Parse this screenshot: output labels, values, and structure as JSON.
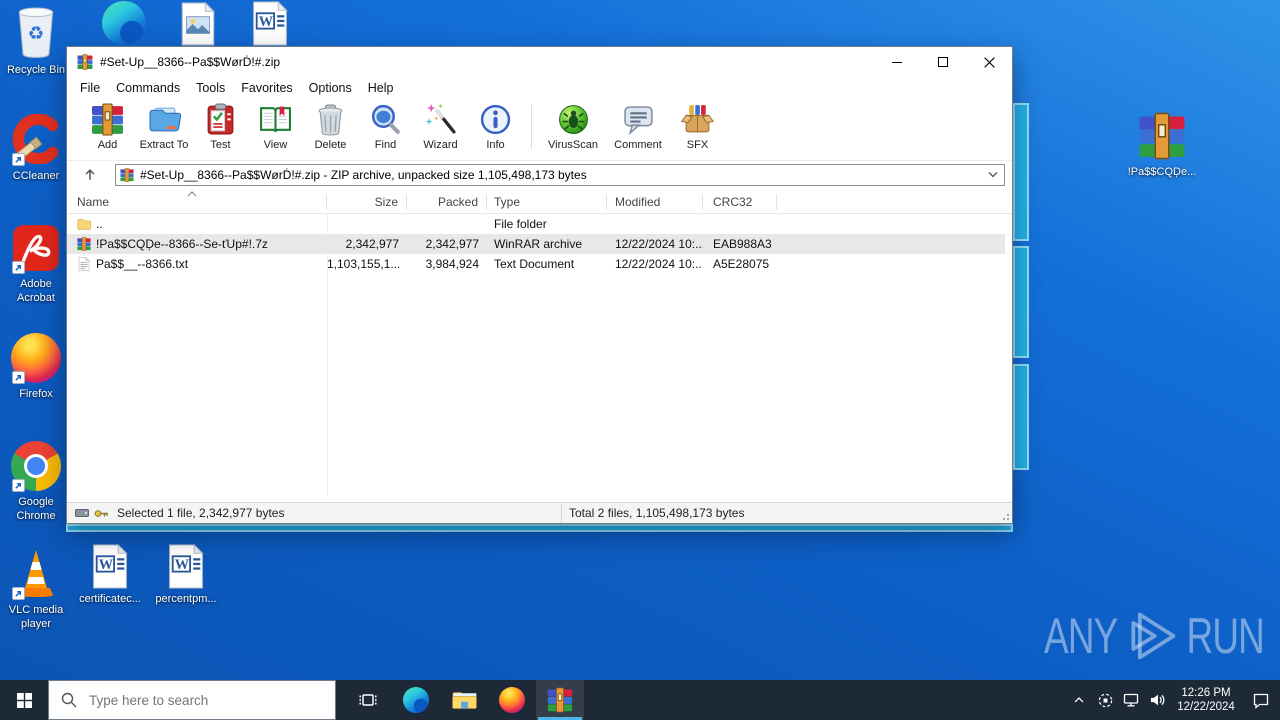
{
  "window": {
    "title": "#Set-Up__8366--Pa$$WørḊ!#.zip",
    "menu": [
      "File",
      "Commands",
      "Tools",
      "Favorites",
      "Options",
      "Help"
    ],
    "toolbar": [
      "Add",
      "Extract To",
      "Test",
      "View",
      "Delete",
      "Find",
      "Wizard",
      "Info",
      "VirusScan",
      "Comment",
      "SFX"
    ],
    "address": "#Set-Up__8366--Pa$$WørḊ!#.zip - ZIP archive, unpacked size 1,105,498,173 bytes",
    "columns": [
      "Name",
      "Size",
      "Packed",
      "Type",
      "Modified",
      "CRC32"
    ],
    "files": [
      {
        "name": "..",
        "size": "",
        "packed": "",
        "type": "File folder",
        "modified": "",
        "crc32": ""
      },
      {
        "name": "!Pa$$CQḐe--8366--Se-ťUp#!.7z",
        "size": "2,342,977",
        "packed": "2,342,977",
        "type": "WinRAR archive",
        "modified": "12/22/2024 10:...",
        "crc32": "EAB988A3"
      },
      {
        "name": "Pa$$__--8366.txt",
        "size": "1,103,155,1...",
        "packed": "3,984,924",
        "type": "Text Document",
        "modified": "12/22/2024 10:...",
        "crc32": "A5E28075"
      }
    ],
    "status_left": "Selected 1 file, 2,342,977 bytes",
    "status_right": "Total 2 files, 1,105,498,173 bytes"
  },
  "desktop": {
    "recycle_bin_label": "Recycle Bin",
    "ccleaner_label": "CCleaner",
    "acrobat_label": "Adobe Acrobat",
    "firefox_label": "Firefox",
    "chrome_label": "Google Chrome",
    "vlc_label": "VLC media player",
    "word_doc1_label": "certificatec...",
    "word_doc2_label": "percentpm...",
    "archive_label": "!Pa$$CQḐe..."
  },
  "taskbar": {
    "search_placeholder": "Type here to search",
    "clock_time": "12:26 PM",
    "clock_date": "12/22/2024"
  },
  "watermark": {
    "left": "ANY",
    "right": "RUN"
  },
  "colors": {
    "wallpaper_blue": "#0d5fc6",
    "beam_cyan": "#24b2ea",
    "taskbar_dark": "#1d2936",
    "selected_row_gray": "#e8e8e8",
    "taskbar_active_underline": "#4cb4f0",
    "title_bar": "#ffffff"
  }
}
